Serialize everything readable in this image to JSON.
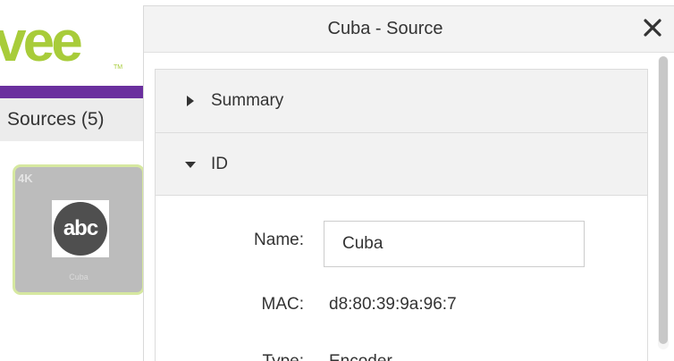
{
  "app": {
    "logo_text": "vee",
    "logo_tm": "TM",
    "sources_label": "Sources (5)",
    "source_card": {
      "badge": "4K",
      "logo_text": "abc",
      "name": "Cuba"
    }
  },
  "modal": {
    "title": "Cuba - Source",
    "close_icon": "close-icon",
    "sections": [
      {
        "label": "Summary",
        "expanded": false
      },
      {
        "label": "ID",
        "expanded": true
      }
    ],
    "fields": {
      "name_label": "Name:",
      "name_value": "Cuba",
      "mac_label": "MAC:",
      "mac_value": "d8:80:39:9a:96:7",
      "type_label": "Type:",
      "type_value": "Encoder"
    }
  },
  "colors": {
    "brand_green": "#a8cc3a",
    "brand_purple": "#6a2f9e"
  }
}
